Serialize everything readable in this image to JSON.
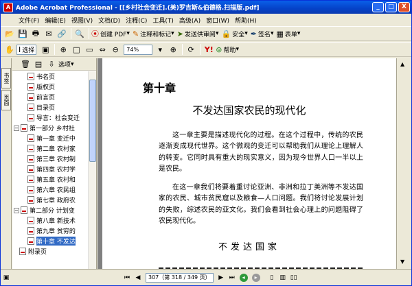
{
  "window": {
    "title": "Adobe Acrobat Professional - [[乡村社会变迁].(美)罗吉斯&伯德格.扫描版.pdf]",
    "minimize": "_",
    "maximize": "□",
    "close": "X"
  },
  "menu": [
    "文件(F)",
    "编辑(E)",
    "视图(V)",
    "文档(D)",
    "注释(C)",
    "工具(T)",
    "高级(A)",
    "窗口(W)",
    "帮助(H)"
  ],
  "toolbar1": {
    "create_pdf": "创建 PDF",
    "comment": "注释和标记",
    "send": "发送供审阅",
    "secure": "安全",
    "sign": "签名",
    "forms": "表单"
  },
  "toolbar2": {
    "select": "选择",
    "zoom_value": "74%",
    "help": "帮助"
  },
  "side_tabs": [
    "书签",
    "页面"
  ],
  "nav": {
    "options": "选项"
  },
  "bookmarks": [
    {
      "label": "书名页",
      "level": 1,
      "toggle": "",
      "selected": false
    },
    {
      "label": "版权页",
      "level": 1,
      "toggle": "",
      "selected": false
    },
    {
      "label": "前言页",
      "level": 1,
      "toggle": "",
      "selected": false
    },
    {
      "label": "目录页",
      "level": 1,
      "toggle": "",
      "selected": false
    },
    {
      "label": "导言：社会变迁",
      "level": 1,
      "toggle": "",
      "selected": false
    },
    {
      "label": "第一部分 乡村社",
      "level": 0,
      "toggle": "−",
      "selected": false
    },
    {
      "label": "第一章 变迁中",
      "level": 1,
      "toggle": "",
      "selected": false
    },
    {
      "label": "第二章 农村家",
      "level": 1,
      "toggle": "",
      "selected": false
    },
    {
      "label": "第三章 农村制",
      "level": 1,
      "toggle": "",
      "selected": false
    },
    {
      "label": "第四章 农村学",
      "level": 1,
      "toggle": "",
      "selected": false
    },
    {
      "label": "第五章 农村和",
      "level": 1,
      "toggle": "",
      "selected": false
    },
    {
      "label": "第六章 农民组",
      "level": 1,
      "toggle": "",
      "selected": false
    },
    {
      "label": "第七章 政府农",
      "level": 1,
      "toggle": "",
      "selected": false
    },
    {
      "label": "第二部分 计划变",
      "level": 0,
      "toggle": "−",
      "selected": false
    },
    {
      "label": "第八章 新技术",
      "level": 1,
      "toggle": "",
      "selected": false
    },
    {
      "label": "第九章 贫穷的",
      "level": 1,
      "toggle": "",
      "selected": false
    },
    {
      "label": "第十章 不发达",
      "level": 1,
      "toggle": "",
      "selected": true
    },
    {
      "label": "附录页",
      "level": 0,
      "toggle": "",
      "selected": false
    }
  ],
  "page": {
    "chapter": "第十章",
    "title": "不发达国家农民的现代化",
    "para1": "这一章主要是描述现代化的过程。在这个过程中，传统的农民逐渐变成现代世界。这个微观的变迁可以帮助我们从理论上理解人的转变。它同时具有重大的现实意义，因为现今世界人口一半以上是农民。",
    "para2": "在这一章我们将要着重讨论亚洲、非洲和拉丁美洲等不发达国家的农民、城市贫民窟以及粮食—人口问题。我们将讨论发展计划的失败，综述农民的亚文化。我们会看到社会心理上的问题阻碍了农民现代化。",
    "subtitle": "不发达国家"
  },
  "status": {
    "page_label": "307（第 318 / 349 页）"
  }
}
